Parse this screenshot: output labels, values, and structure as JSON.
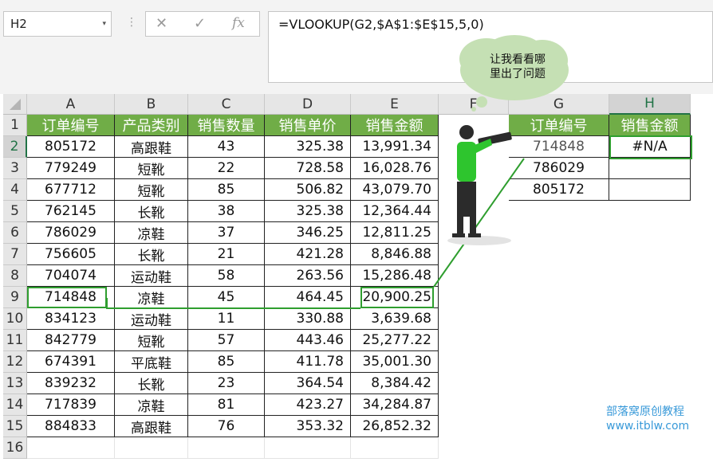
{
  "namebox": {
    "value": "H2",
    "dropdown_glyph": "▾"
  },
  "formula_bar": {
    "dots": "⋮",
    "cancel_glyph": "✕",
    "enter_glyph": "✓",
    "fx_label": "fx",
    "formula": "=VLOOKUP(G2,$A$1:$E$15,5,0)"
  },
  "columns": [
    "A",
    "B",
    "C",
    "D",
    "E",
    "F",
    "G",
    "H"
  ],
  "rows": [
    "1",
    "2",
    "3",
    "4",
    "5",
    "6",
    "7",
    "8",
    "9",
    "10",
    "11",
    "12",
    "13",
    "14",
    "15",
    "16"
  ],
  "table": {
    "headers": [
      "订单编号",
      "产品类别",
      "销售数量",
      "销售单价",
      "销售金额"
    ],
    "rows": [
      [
        "805172",
        "高跟鞋",
        "43",
        "325.38",
        "13,991.34"
      ],
      [
        "779249",
        "短靴",
        "22",
        "728.58",
        "16,028.76"
      ],
      [
        "677712",
        "短靴",
        "85",
        "506.82",
        "43,079.70"
      ],
      [
        "762145",
        "长靴",
        "38",
        "325.38",
        "12,364.44"
      ],
      [
        "786029",
        "凉鞋",
        "37",
        "346.25",
        "12,811.25"
      ],
      [
        "756605",
        "长靴",
        "21",
        "421.28",
        "8,846.88"
      ],
      [
        "704074",
        "运动鞋",
        "58",
        "263.56",
        "15,286.48"
      ],
      [
        "714848",
        "凉鞋",
        "45",
        "464.45",
        "20,900.25"
      ],
      [
        "834123",
        "运动鞋",
        "11",
        "330.88",
        "3,639.68"
      ],
      [
        "842779",
        "短靴",
        "57",
        "443.46",
        "25,277.22"
      ],
      [
        "674391",
        "平底鞋",
        "85",
        "411.78",
        "35,001.30"
      ],
      [
        "839232",
        "长靴",
        "23",
        "364.54",
        "8,384.42"
      ],
      [
        "717839",
        "凉鞋",
        "81",
        "423.27",
        "34,284.87"
      ],
      [
        "884833",
        "高跟鞋",
        "76",
        "353.32",
        "26,852.32"
      ]
    ]
  },
  "lookup": {
    "headers": [
      "订单编号",
      "销售金额"
    ],
    "rows": [
      [
        "714848",
        "#N/A"
      ],
      [
        "786029",
        ""
      ],
      [
        "805172",
        ""
      ]
    ]
  },
  "speech_bubble": {
    "line1": "让我看看哪",
    "line2": "里出了问题"
  },
  "watermark": {
    "line1": "部落窝原创教程",
    "line2": "www.itblw.com"
  },
  "colors": {
    "header_green": "#70ad47",
    "highlight_green": "#2f9e2f",
    "bubble": "#c5e0b4",
    "excel_green": "#217346"
  }
}
